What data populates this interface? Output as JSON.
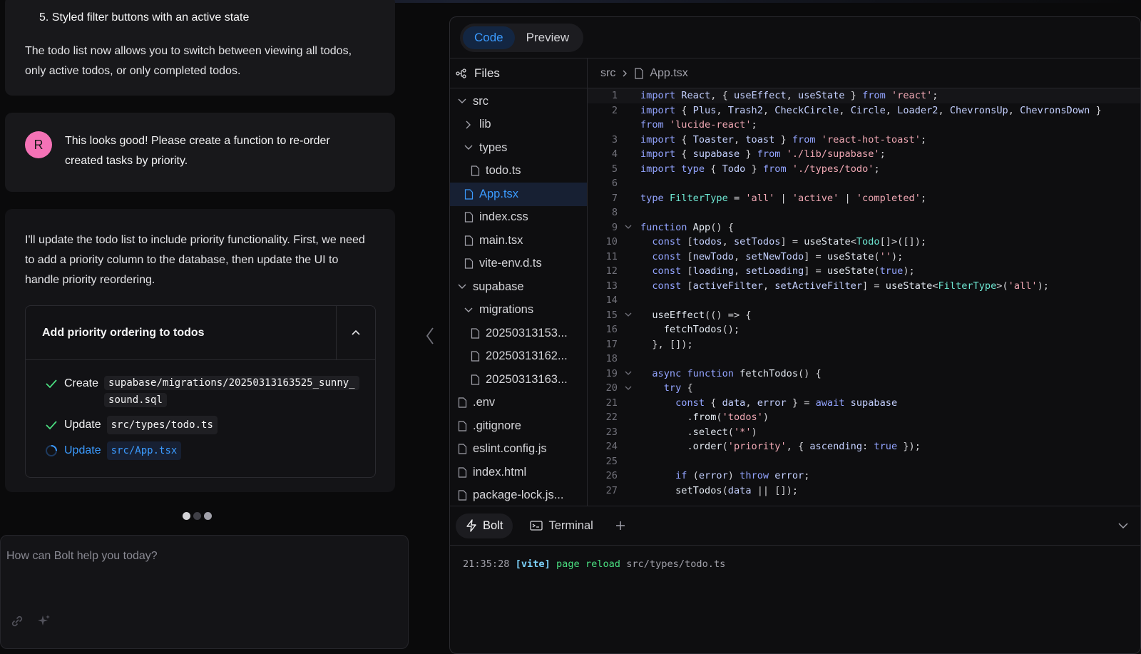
{
  "chat": {
    "prev_list_item": "5. Styled filter buttons with an active state",
    "prev_paragraph": "The todo list now allows you to switch between viewing all todos, only active todos, or only completed todos.",
    "user_initial": "R",
    "user_message": "This looks good! Please create a function to re-order created tasks by priority.",
    "ai_message": "I'll update the todo list to include priority functionality. First, we need to add a priority column to the database, then update the UI to handle priority reordering.",
    "artifact": {
      "title": "Add priority ordering to todos",
      "actions": [
        {
          "status": "done",
          "verb": "Create",
          "path": "supabase/migrations/20250313163525_sunny_sound.sql"
        },
        {
          "status": "done",
          "verb": "Update",
          "path": "src/types/todo.ts"
        },
        {
          "status": "running",
          "verb": "Update",
          "path": "src/App.tsx"
        }
      ]
    },
    "prompt_placeholder": "How can Bolt help you today?"
  },
  "workbench": {
    "tabs": {
      "code": "Code",
      "preview": "Preview"
    },
    "files_label": "Files",
    "breadcrumb": {
      "folder": "src",
      "file": "App.tsx"
    },
    "tree": [
      {
        "label": "src",
        "type": "folder-open",
        "depth": 0
      },
      {
        "label": "lib",
        "type": "folder-closed",
        "depth": 1
      },
      {
        "label": "types",
        "type": "folder-open",
        "depth": 1
      },
      {
        "label": "todo.ts",
        "type": "file",
        "depth": 2
      },
      {
        "label": "App.tsx",
        "type": "file",
        "depth": 1,
        "selected": true
      },
      {
        "label": "index.css",
        "type": "file",
        "depth": 1
      },
      {
        "label": "main.tsx",
        "type": "file",
        "depth": 1
      },
      {
        "label": "vite-env.d.ts",
        "type": "file",
        "depth": 1
      },
      {
        "label": "supabase",
        "type": "folder-open",
        "depth": 0
      },
      {
        "label": "migrations",
        "type": "folder-open",
        "depth": 1
      },
      {
        "label": "20250313153...",
        "type": "file",
        "depth": 2
      },
      {
        "label": "20250313162...",
        "type": "file",
        "depth": 2
      },
      {
        "label": "20250313163...",
        "type": "file",
        "depth": 2
      },
      {
        "label": ".env",
        "type": "file",
        "depth": 0
      },
      {
        "label": ".gitignore",
        "type": "file",
        "depth": 0
      },
      {
        "label": "eslint.config.js",
        "type": "file",
        "depth": 0
      },
      {
        "label": "index.html",
        "type": "file",
        "depth": 0
      },
      {
        "label": "package-lock.js...",
        "type": "file",
        "depth": 0
      }
    ],
    "code_lines": [
      {
        "n": "1",
        "fold": false,
        "html": "<span class='k'>import</span> <span class='v'>React</span>, { <span class='v'>useEffect</span>, <span class='v'>useState</span> } <span class='k'>from</span> <span class='s'>'react'</span>;"
      },
      {
        "n": "2",
        "fold": false,
        "html": "<span class='k'>import</span> { <span class='v'>Plus</span>, <span class='v'>Trash2</span>, <span class='v'>CheckCircle</span>, <span class='v'>Circle</span>, <span class='v'>Loader2</span>, <span class='v'>ChevronsUp</span>, <span class='v'>ChevronsDown</span> }"
      },
      {
        "n": "",
        "fold": false,
        "html": "<span class='k'>from</span> <span class='s'>'lucide-react'</span>;"
      },
      {
        "n": "3",
        "fold": false,
        "html": "<span class='k'>import</span> { <span class='v'>Toaster</span>, <span class='v'>toast</span> } <span class='k'>from</span> <span class='s'>'react-hot-toast'</span>;"
      },
      {
        "n": "4",
        "fold": false,
        "html": "<span class='k'>import</span> { <span class='v'>supabase</span> } <span class='k'>from</span> <span class='s'>'./lib/supabase'</span>;"
      },
      {
        "n": "5",
        "fold": false,
        "html": "<span class='k'>import</span> <span class='k'>type</span> { <span class='v'>Todo</span> } <span class='k'>from</span> <span class='s'>'./types/todo'</span>;"
      },
      {
        "n": "6",
        "fold": false,
        "html": ""
      },
      {
        "n": "7",
        "fold": false,
        "html": "<span class='k'>type</span> <span class='t'>FilterType</span> = <span class='s'>'all'</span> | <span class='s'>'active'</span> | <span class='s'>'completed'</span>;"
      },
      {
        "n": "8",
        "fold": false,
        "html": ""
      },
      {
        "n": "9",
        "fold": true,
        "html": "<span class='k'>function</span> <span class='f'>App</span>() {"
      },
      {
        "n": "10",
        "fold": false,
        "html": "  <span class='k'>const</span> [<span class='v'>todos</span>, <span class='v'>setTodos</span>] = <span class='f'>useState</span>&lt;<span class='t'>Todo</span>[]&gt;([]);"
      },
      {
        "n": "11",
        "fold": false,
        "html": "  <span class='k'>const</span> [<span class='v'>newTodo</span>, <span class='v'>setNewTodo</span>] = <span class='f'>useState</span>(<span class='s'>''</span>);"
      },
      {
        "n": "12",
        "fold": false,
        "html": "  <span class='k'>const</span> [<span class='v'>loading</span>, <span class='v'>setLoading</span>] = <span class='f'>useState</span>(<span class='kc'>true</span>);"
      },
      {
        "n": "13",
        "fold": false,
        "html": "  <span class='k'>const</span> [<span class='v'>activeFilter</span>, <span class='v'>setActiveFilter</span>] = <span class='f'>useState</span>&lt;<span class='t'>FilterType</span>&gt;(<span class='s'>'all'</span>);"
      },
      {
        "n": "14",
        "fold": false,
        "html": ""
      },
      {
        "n": "15",
        "fold": true,
        "html": "  <span class='f'>useEffect</span>(() =&gt; {"
      },
      {
        "n": "16",
        "fold": false,
        "html": "    <span class='f'>fetchTodos</span>();"
      },
      {
        "n": "17",
        "fold": false,
        "html": "  }, []);"
      },
      {
        "n": "18",
        "fold": false,
        "html": ""
      },
      {
        "n": "19",
        "fold": true,
        "html": "  <span class='k'>async</span> <span class='k'>function</span> <span class='f'>fetchTodos</span>() {"
      },
      {
        "n": "20",
        "fold": true,
        "html": "    <span class='k'>try</span> {"
      },
      {
        "n": "21",
        "fold": false,
        "html": "      <span class='k'>const</span> { <span class='v'>data</span>, <span class='v'>error</span> } = <span class='k'>await</span> <span class='v'>supabase</span>"
      },
      {
        "n": "22",
        "fold": false,
        "html": "        .<span class='f'>from</span>(<span class='s'>'todos'</span>)"
      },
      {
        "n": "23",
        "fold": false,
        "html": "        .<span class='f'>select</span>(<span class='s'>'*'</span>)"
      },
      {
        "n": "24",
        "fold": false,
        "html": "        .<span class='f'>order</span>(<span class='s'>'priority'</span>, { <span class='v'>ascending</span>: <span class='kc'>true</span> });"
      },
      {
        "n": "25",
        "fold": false,
        "html": ""
      },
      {
        "n": "26",
        "fold": false,
        "html": "      <span class='k'>if</span> (<span class='v'>error</span>) <span class='k'>throw</span> <span class='v'>error</span>;"
      },
      {
        "n": "27",
        "fold": false,
        "html": "      <span class='f'>setTodos</span>(<span class='v'>data</span> || []);"
      }
    ],
    "terminal_tabs": {
      "bolt": "Bolt",
      "terminal": "Terminal"
    },
    "terminal_log": {
      "time": "21:35:28",
      "tag": "[vite]",
      "msg": "page reload",
      "path": "src/types/todo.ts"
    }
  },
  "colors": {
    "accent": "#3b9bff",
    "avatar": "#f472b6",
    "check": "#4ade80"
  }
}
